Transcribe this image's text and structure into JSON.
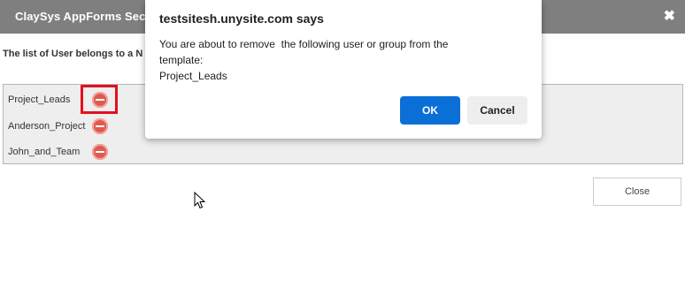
{
  "window": {
    "title": "ClaySys AppForms Secu",
    "close_glyph": "✖"
  },
  "subtitle": "The list of User belongs to a N",
  "users": [
    {
      "name": "Project_Leads",
      "action_icon": "remove-icon"
    },
    {
      "name": "Anderson_Project",
      "action_icon": "remove-icon"
    },
    {
      "name": "John_and_Team",
      "action_icon": "remove-icon"
    }
  ],
  "close_button_label": "Close",
  "dialog": {
    "title": "testsitesh.unysite.com says",
    "message": "You are about to remove  the following user or group from the\ntemplate:\nProject_Leads",
    "ok_label": "OK",
    "cancel_label": "Cancel"
  },
  "colors": {
    "title_bar": "#7f7f7f",
    "remove_icon": "#e05a4f",
    "highlight": "#e3101c",
    "ok_button": "#0a6fd6"
  }
}
